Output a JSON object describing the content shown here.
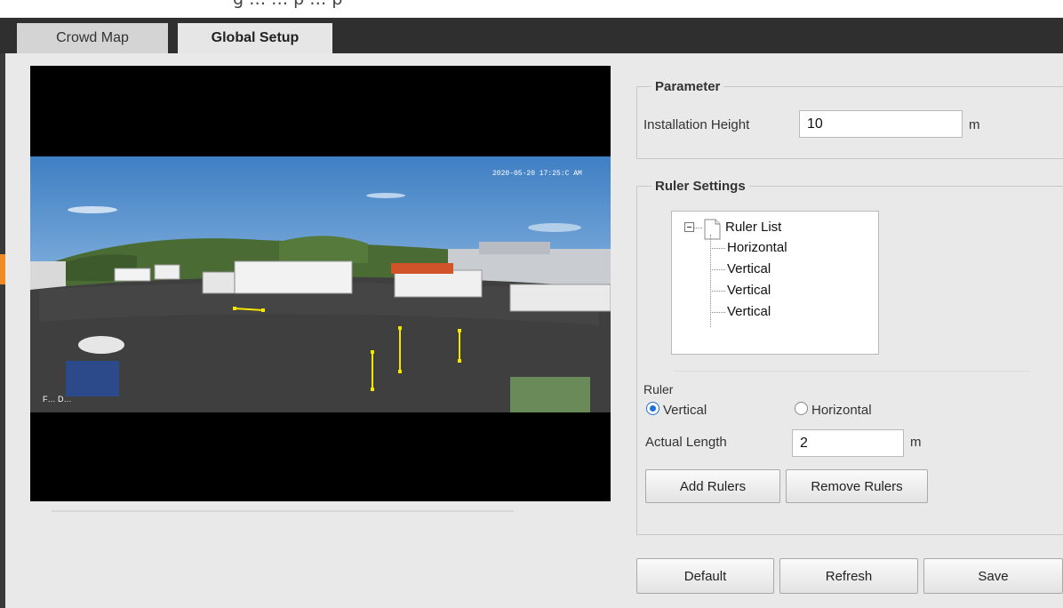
{
  "window": {
    "top_fragment": "g … … p … p"
  },
  "tabs": [
    {
      "label": "Crowd Map",
      "active": false
    },
    {
      "label": "Global Setup",
      "active": true
    }
  ],
  "video": {
    "timestamp": "2020-05-20 17:25:C  AM",
    "watermark": "F… D…",
    "rulers": [
      {
        "type": "Horizontal"
      },
      {
        "type": "Vertical"
      },
      {
        "type": "Vertical"
      },
      {
        "type": "Vertical"
      }
    ]
  },
  "parameter": {
    "legend": "Parameter",
    "installation_height_label": "Installation Height",
    "installation_height_value": "10",
    "unit": "m"
  },
  "ruler_settings": {
    "legend": "Ruler Settings",
    "tree": {
      "root": "Ruler List",
      "items": [
        "Horizontal",
        "Vertical",
        "Vertical",
        "Vertical"
      ]
    },
    "ruler_label": "Ruler",
    "radio_vertical": "Vertical",
    "radio_horizontal": "Horizontal",
    "selected_type": "Vertical",
    "actual_length_label": "Actual Length",
    "actual_length_value": "2",
    "unit": "m",
    "add_button": "Add Rulers",
    "remove_button": "Remove Rulers"
  },
  "footer": {
    "default_button": "Default",
    "refresh_button": "Refresh",
    "save_button": "Save"
  },
  "colors": {
    "tab_bar": "#2f2f2f",
    "panel_bg": "#e9e9e9",
    "ruler_yellow": "#f5e600",
    "accent_orange": "#f08a24",
    "radio_blue": "#1f6fd8"
  }
}
